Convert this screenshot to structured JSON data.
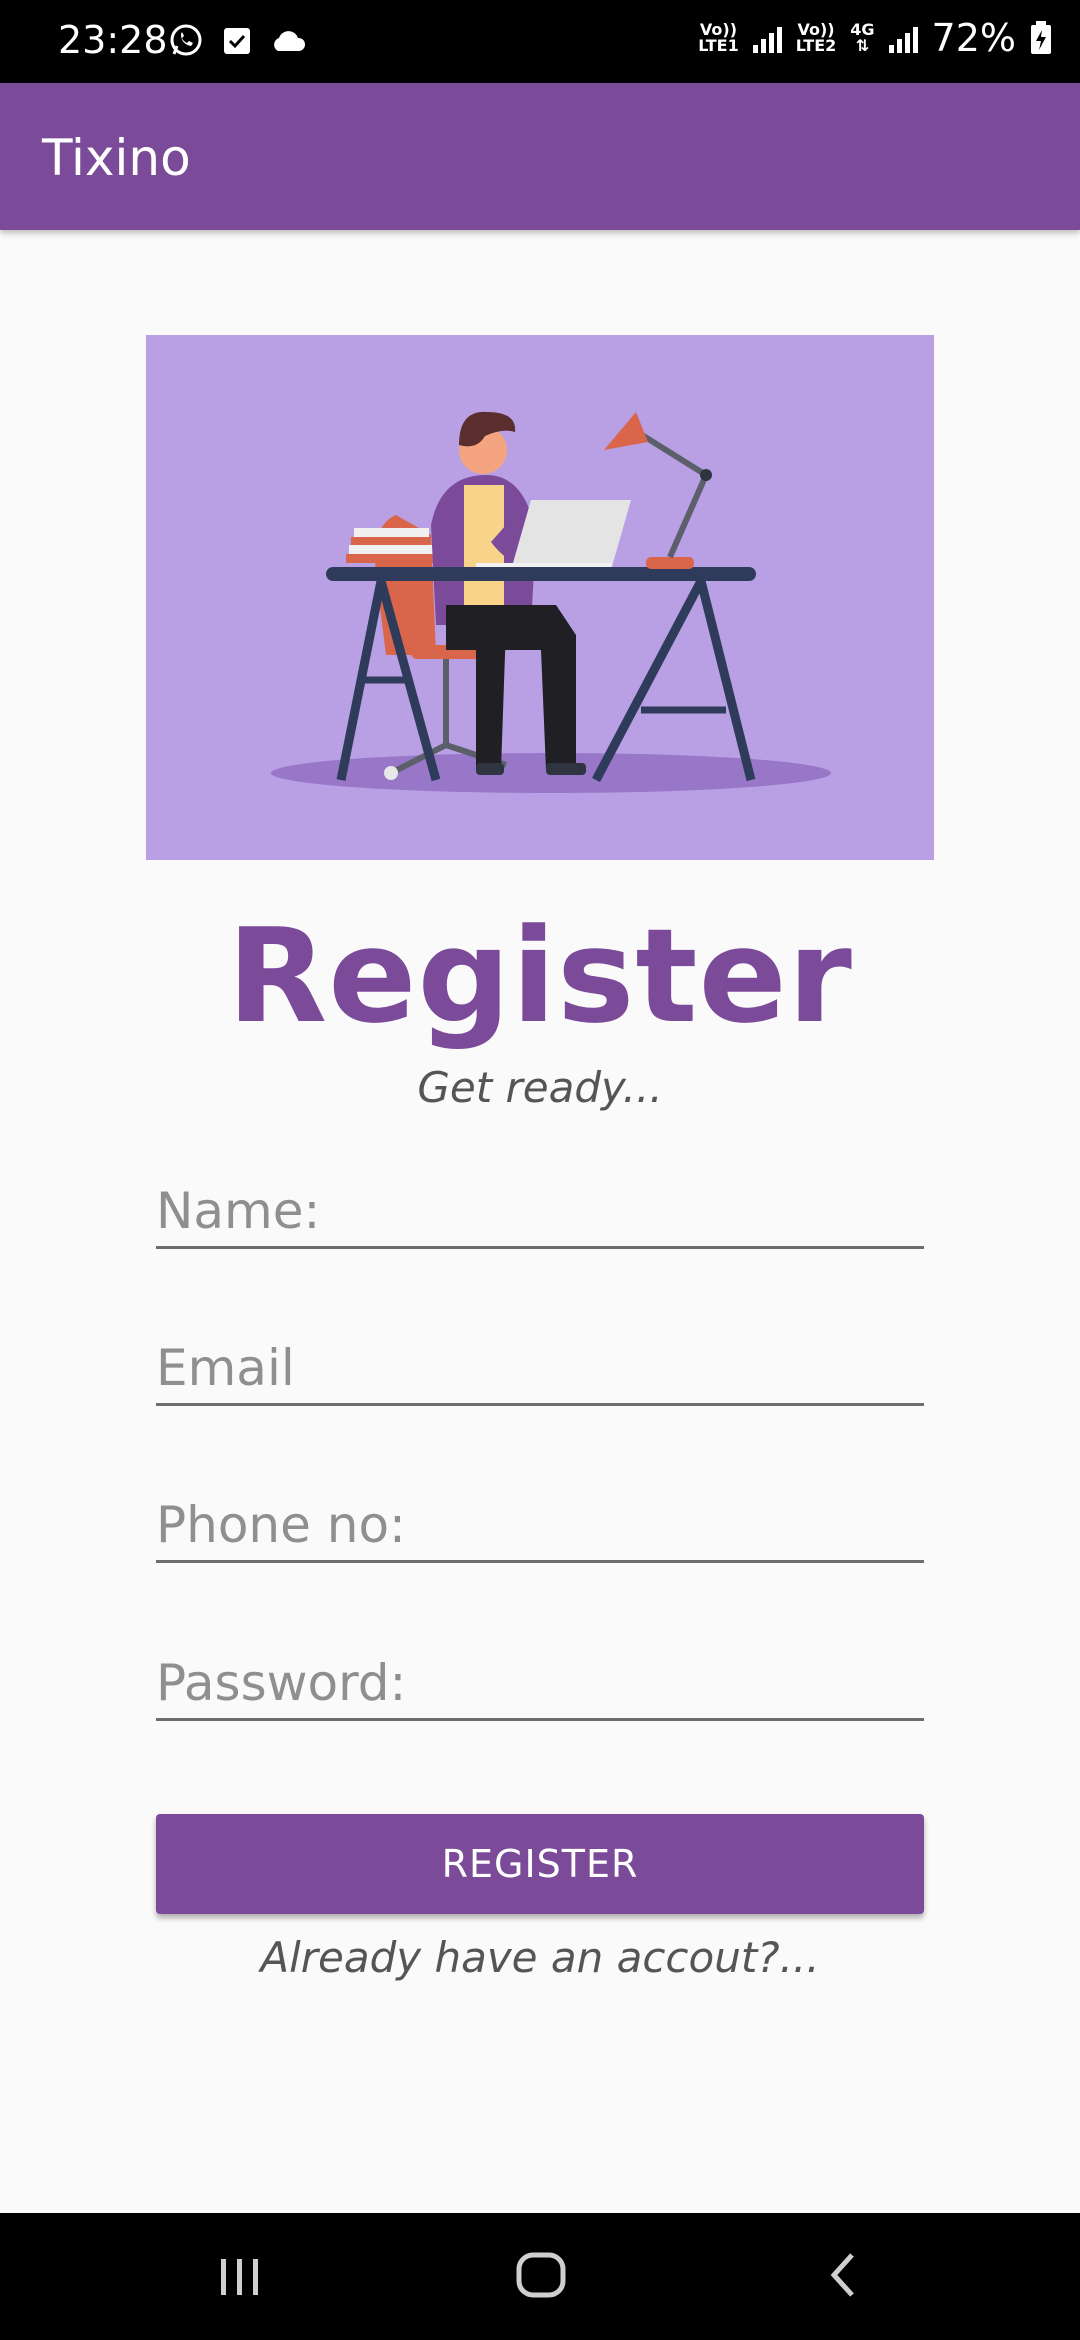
{
  "status_bar": {
    "time": "23:28",
    "sim1": [
      "Vo))",
      "LTE1"
    ],
    "sim2": [
      "Vo))",
      "LTE2"
    ],
    "network": "4G",
    "battery": "72%",
    "icons": [
      "whatsapp-icon",
      "check-box-icon",
      "cloud-icon",
      "signal-icon",
      "battery-charging-icon"
    ]
  },
  "app_bar": {
    "title": "Tixino"
  },
  "register": {
    "title": "Register",
    "subtitle": "Get ready...",
    "fields": {
      "name_placeholder": "Name:",
      "email_placeholder": "Email",
      "phone_placeholder": "Phone no:",
      "password_placeholder": "Password:"
    },
    "button_label": "REGISTER",
    "login_link": "Already have an accout?..."
  },
  "nav_bar": {
    "icons": [
      "recent-apps-icon",
      "home-icon",
      "back-icon"
    ]
  },
  "colors": {
    "primary": "#7b4a99",
    "hero_background": "#b9a0e4"
  }
}
